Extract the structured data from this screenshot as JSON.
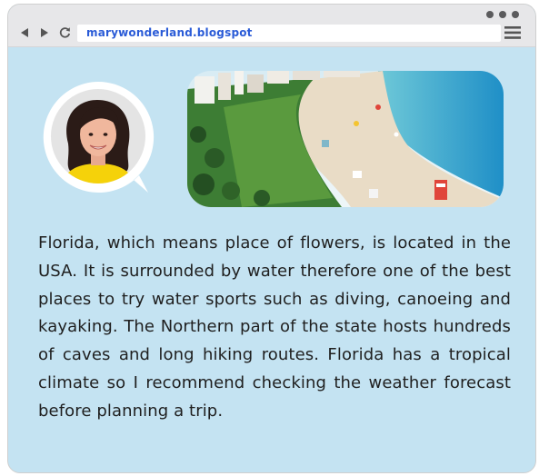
{
  "browser": {
    "url": "marywonderland.blogspot"
  },
  "icons": {
    "back": "back-arrow-icon",
    "forward": "forward-arrow-icon",
    "reload": "reload-icon",
    "menu": "hamburger-menu-icon",
    "window_controls": "three-dots-icon"
  },
  "post": {
    "body": "Florida, which means place of flowers, is located in the USA. It is surrounded by water therefore one of the best places to try water sports such as diving, canoeing and kayaking. The Northern part of the state hosts hundreds of caves and long hiking routes. Florida has a tropical climate so I recommend checking the weather forecast before planning a trip."
  },
  "colors": {
    "page_background": "#c4e3f2",
    "url_text": "#2a5bd7",
    "avatar_shirt": "#f5d20a"
  }
}
